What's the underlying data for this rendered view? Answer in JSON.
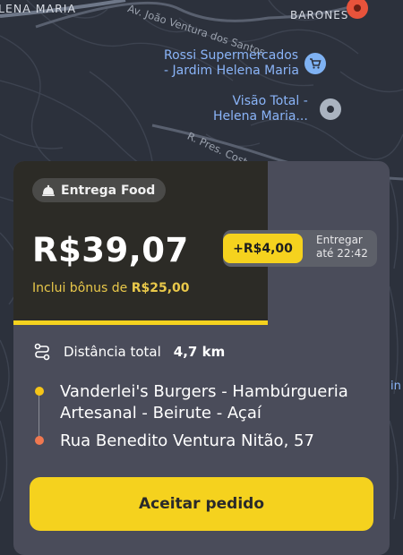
{
  "map": {
    "area_left": "LENA MARIA",
    "area_right": "BARONES",
    "street_top": "Av. João Ventura dos Santos",
    "street_mid": "R. Pres. Costa",
    "poi_rossi": [
      "Rossi Supermercados",
      "- Jardim Helena Maria"
    ],
    "poi_visao": [
      "Visão Total -",
      "Helena Maria..."
    ],
    "edge_text": "in",
    "colors": {
      "background": "#2c313c",
      "poi_text": "#8ab4f8",
      "destination": "#e8533b"
    }
  },
  "order": {
    "badge_label": "Entrega Food",
    "price": "R$39,07",
    "bonus_prefix": "Inclui bônus de ",
    "bonus_value": "R$25,00",
    "extra_amount": "+R$4,00",
    "deliver_label": "Entregar",
    "deliver_time": "até 22:42",
    "distance_label": "Distância total",
    "distance_value": "4,7 km",
    "pickup": "Vanderlei's Burgers - Hambúrgueria Artesanal - Beirute - Açaí",
    "dropoff": "Rua Benedito Ventura Nitão, 57",
    "accept_label": "Aceitar pedido",
    "colors": {
      "accent": "#f5d21e",
      "card": "#4a4c5a",
      "panel": "#2c2b26",
      "pickup_dot": "#f5c518",
      "dropoff_dot": "#f07850"
    }
  }
}
